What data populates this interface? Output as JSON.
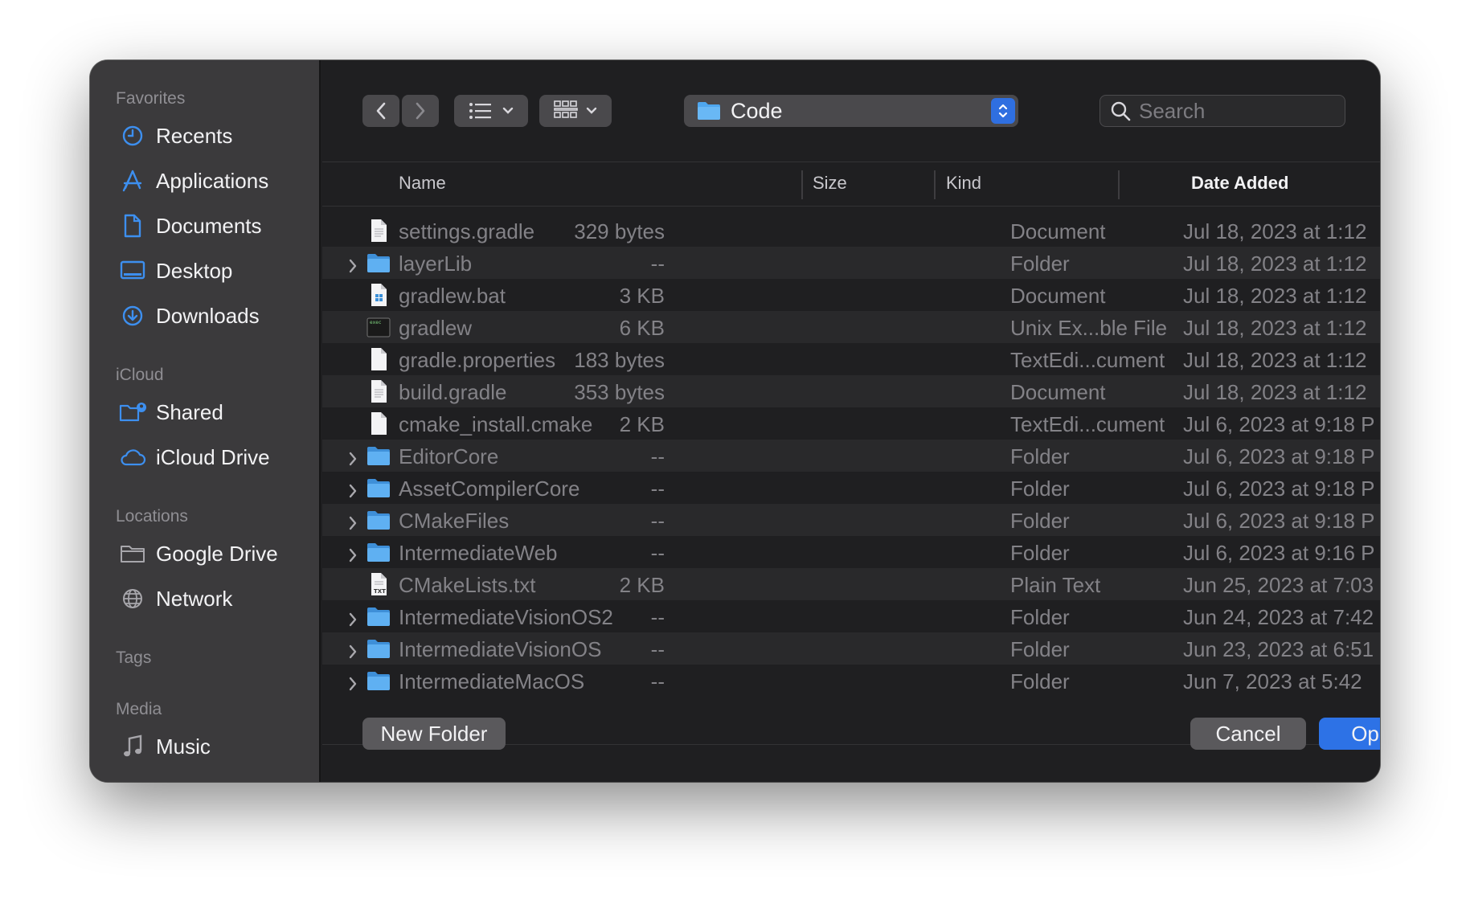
{
  "sidebar": {
    "sections": {
      "favorites": "Favorites",
      "icloud": "iCloud",
      "locations": "Locations",
      "tags": "Tags",
      "media": "Media"
    },
    "favorites": [
      {
        "label": "Recents",
        "icon": "clock-icon"
      },
      {
        "label": "Applications",
        "icon": "applications-icon"
      },
      {
        "label": "Documents",
        "icon": "document-icon"
      },
      {
        "label": "Desktop",
        "icon": "desktop-icon"
      },
      {
        "label": "Downloads",
        "icon": "download-icon"
      }
    ],
    "icloud": [
      {
        "label": "Shared",
        "icon": "shared-folder-icon"
      },
      {
        "label": "iCloud Drive",
        "icon": "cloud-icon"
      }
    ],
    "locations": [
      {
        "label": "Google Drive",
        "icon": "folder-outline-icon"
      },
      {
        "label": "Network",
        "icon": "globe-icon"
      }
    ],
    "media": [
      {
        "label": "Music",
        "icon": "music-note-icon"
      }
    ]
  },
  "toolbar": {
    "path_folder": "Code",
    "search_placeholder": "Search"
  },
  "columns": {
    "name": "Name",
    "size": "Size",
    "kind": "Kind",
    "date": "Date Added"
  },
  "files": [
    {
      "name": "settings.gradle",
      "size": "329 bytes",
      "kind": "Document",
      "date": "Jul 18, 2023 at 1:12",
      "icon": "document-icon",
      "folder": false
    },
    {
      "name": "layerLib",
      "size": "--",
      "kind": "Folder",
      "date": "Jul 18, 2023 at 1:12",
      "icon": "folder-icon",
      "folder": true
    },
    {
      "name": "gradlew.bat",
      "size": "3 KB",
      "kind": "Document",
      "date": "Jul 18, 2023 at 1:12",
      "icon": "windows-doc-icon",
      "folder": false
    },
    {
      "name": "gradlew",
      "size": "6 KB",
      "kind": "Unix Ex...ble File",
      "date": "Jul 18, 2023 at 1:12",
      "icon": "terminal-icon",
      "folder": false
    },
    {
      "name": "gradle.properties",
      "size": "183 bytes",
      "kind": "TextEdi...cument",
      "date": "Jul 18, 2023 at 1:12",
      "icon": "blank-doc-icon",
      "folder": false
    },
    {
      "name": "build.gradle",
      "size": "353 bytes",
      "kind": "Document",
      "date": "Jul 18, 2023 at 1:12",
      "icon": "document-icon",
      "folder": false
    },
    {
      "name": "cmake_install.cmake",
      "size": "2 KB",
      "kind": "TextEdi...cument",
      "date": "Jul 6, 2023 at 9:18 P",
      "icon": "blank-doc-icon",
      "folder": false
    },
    {
      "name": "EditorCore",
      "size": "--",
      "kind": "Folder",
      "date": "Jul 6, 2023 at 9:18 P",
      "icon": "folder-icon",
      "folder": true
    },
    {
      "name": "AssetCompilerCore",
      "size": "--",
      "kind": "Folder",
      "date": "Jul 6, 2023 at 9:18 P",
      "icon": "folder-icon",
      "folder": true
    },
    {
      "name": "CMakeFiles",
      "size": "--",
      "kind": "Folder",
      "date": "Jul 6, 2023 at 9:18 P",
      "icon": "folder-icon",
      "folder": true
    },
    {
      "name": "IntermediateWeb",
      "size": "--",
      "kind": "Folder",
      "date": "Jul 6, 2023 at 9:16 P",
      "icon": "folder-icon",
      "folder": true
    },
    {
      "name": "CMakeLists.txt",
      "size": "2 KB",
      "kind": "Plain Text",
      "date": "Jun 25, 2023 at 7:03",
      "icon": "txt-doc-icon",
      "folder": false
    },
    {
      "name": "IntermediateVisionOS2",
      "size": "--",
      "kind": "Folder",
      "date": "Jun 24, 2023 at 7:42",
      "icon": "folder-icon",
      "folder": true
    },
    {
      "name": "IntermediateVisionOS",
      "size": "--",
      "kind": "Folder",
      "date": "Jun 23, 2023 at 6:51",
      "icon": "folder-icon",
      "folder": true
    },
    {
      "name": "IntermediateMacOS",
      "size": "--",
      "kind": "Folder",
      "date": "Jun 7, 2023 at 5:42",
      "icon": "folder-icon",
      "folder": true
    }
  ],
  "buttons": {
    "new_folder": "New Folder",
    "cancel": "Cancel",
    "open": "Open"
  },
  "colors": {
    "accent": "#2d72e6",
    "sidebar_icon": "#3d8fef",
    "folder": "#4fa7ef"
  }
}
